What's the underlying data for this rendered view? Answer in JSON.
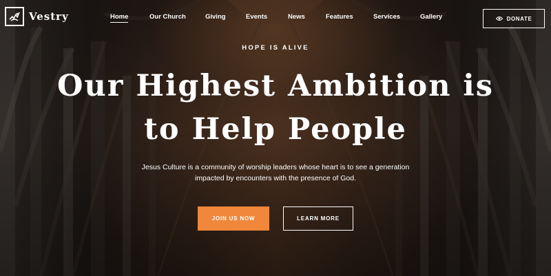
{
  "brand": {
    "name": "Vestry",
    "logo_icon": "dove-flame-icon"
  },
  "nav": {
    "items": [
      {
        "label": "Home",
        "active": true
      },
      {
        "label": "Our Church",
        "active": false
      },
      {
        "label": "Giving",
        "active": false
      },
      {
        "label": "Events",
        "active": false
      },
      {
        "label": "News",
        "active": false
      },
      {
        "label": "Features",
        "active": false
      },
      {
        "label": "Services",
        "active": false
      },
      {
        "label": "Gallery",
        "active": false
      }
    ]
  },
  "donate": {
    "label": "DONATE",
    "icon": "eye-icon"
  },
  "hero": {
    "eyebrow": "HOPE IS ALIVE",
    "headline_line1": "Our Highest Ambition is",
    "headline_line2": "to Help People",
    "subtext_line1": "Jesus Culture is a community of worship leaders whose heart is to see a generation",
    "subtext_line2": "impacted by encounters with the presence of God.",
    "primary_button": "JOIN US NOW",
    "secondary_button": "LEARN MORE"
  },
  "colors": {
    "accent": "#f0873a",
    "text": "#ffffff",
    "background": "#1d1714"
  }
}
